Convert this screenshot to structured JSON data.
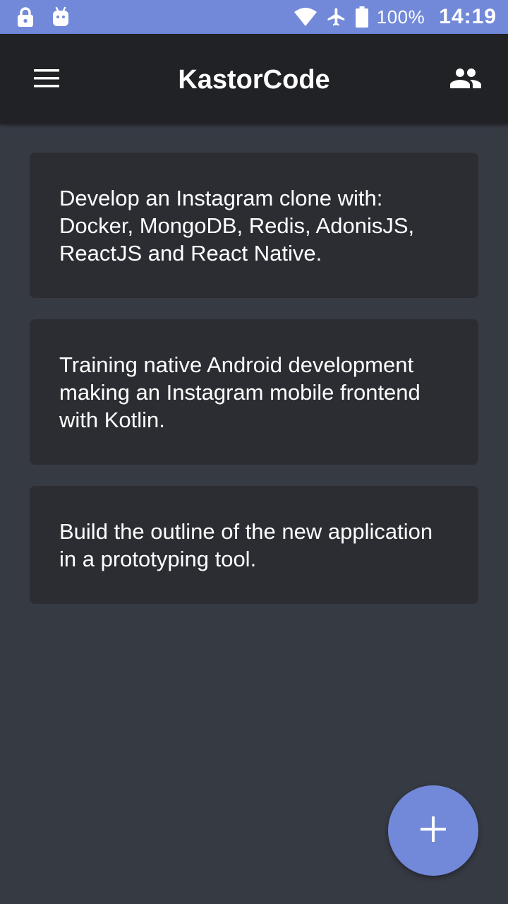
{
  "status_bar": {
    "icons_left": [
      "lock-icon",
      "android-icon"
    ],
    "icons_right": [
      "wifi-icon",
      "airplane-icon",
      "battery-icon"
    ],
    "battery_percent": "100%",
    "time": "14:19",
    "background": "#7289da"
  },
  "app_bar": {
    "title": "KastorCode",
    "menu_icon": "hamburger-menu-icon",
    "action_icon": "people-icon",
    "background": "#202226"
  },
  "cards": [
    {
      "text": "Develop an Instagram clone with: Docker, MongoDB, Redis, AdonisJS, ReactJS and React Native."
    },
    {
      "text": "Training native Android development making an Instagram mobile frontend with Kotlin."
    },
    {
      "text": "Build the outline of the new application in a prototyping tool."
    }
  ],
  "fab": {
    "icon": "plus-icon",
    "color": "#7289da"
  },
  "theme": {
    "background": "#363a43",
    "card_background": "#2b2d32",
    "text": "#ffffff"
  }
}
